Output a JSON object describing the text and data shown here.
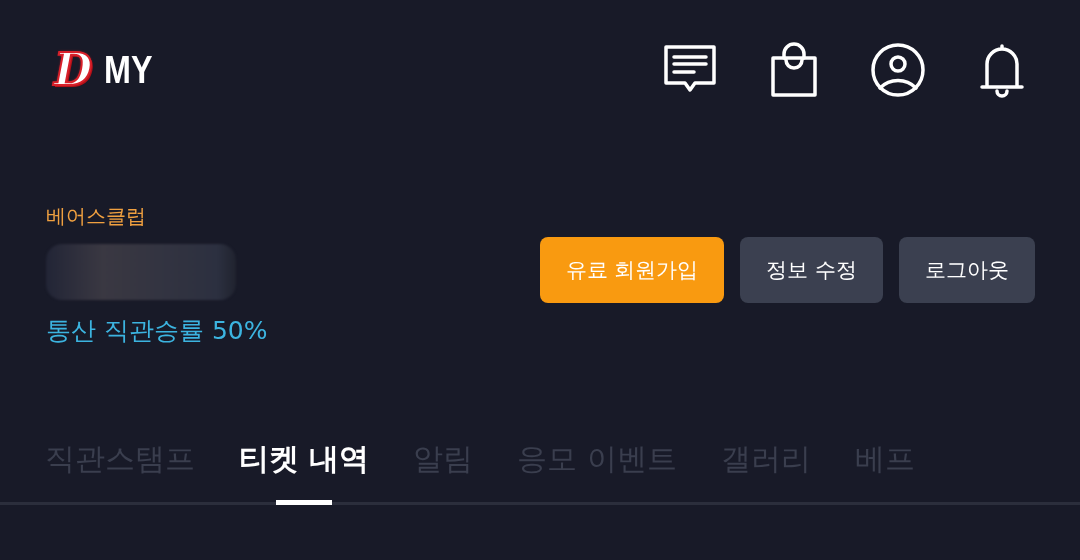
{
  "header": {
    "logo": "D",
    "title": "MY"
  },
  "profile": {
    "membership": "베어스클럽",
    "win_rate": "통산 직관승률 50%"
  },
  "buttons": [
    {
      "label": "유료 회원가입",
      "kind": "primary"
    },
    {
      "label": "정보 수정",
      "kind": "secondary"
    },
    {
      "label": "로그아웃",
      "kind": "secondary"
    }
  ],
  "tabs": [
    {
      "label": "직관스탬프",
      "selected": false
    },
    {
      "label": "티켓 내역",
      "selected": true
    },
    {
      "label": "알림",
      "selected": false
    },
    {
      "label": "응모 이벤트",
      "selected": false
    },
    {
      "label": "갤러리",
      "selected": false
    },
    {
      "label": "베프",
      "selected": false
    }
  ]
}
